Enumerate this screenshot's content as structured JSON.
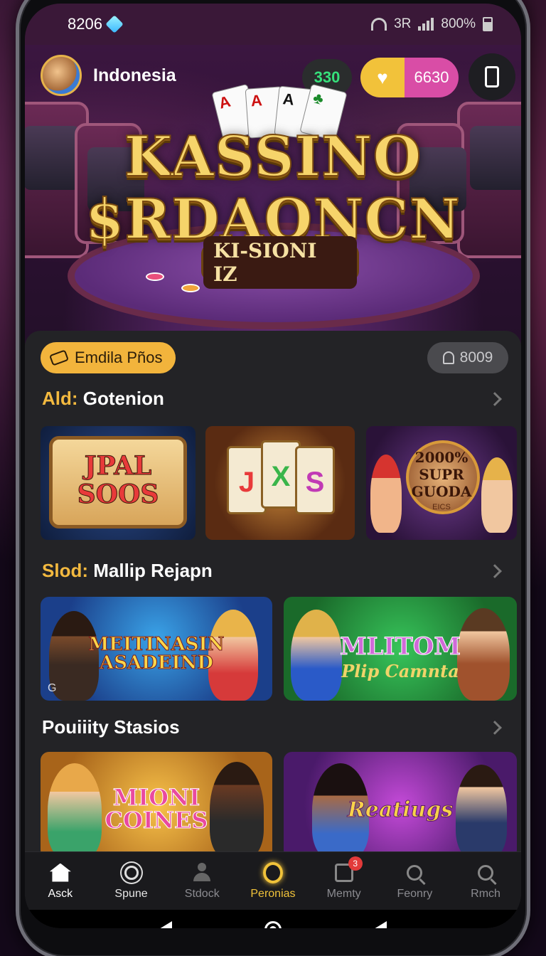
{
  "status": {
    "time": "8206",
    "carrier_text": "3R",
    "battery": "800%"
  },
  "header": {
    "country": "Indonesia",
    "green_counter": "330",
    "coin_value": "6630"
  },
  "hero": {
    "title_line1": "KASSINO",
    "title_line2": "$RDAONCN",
    "subtitle": "KI-SIONI IZ",
    "cards": [
      "A",
      "A",
      "A"
    ]
  },
  "promo": {
    "label": "Emdila Pños",
    "count": "8009"
  },
  "sections": [
    {
      "accent": "Ald:",
      "title": "Gotenion"
    },
    {
      "accent": "Slod:",
      "title": "Mallip Rejapn"
    },
    {
      "accent": "",
      "title": "Pouiiity Stasios"
    }
  ],
  "tiles": {
    "t1_line1": "JPAL",
    "t1_line2": "SOOS",
    "t2_reels": [
      "J",
      "X",
      "S"
    ],
    "t3_line1": "2000%",
    "t3_line2": "SUPR",
    "t3_line3": "GUODA",
    "t3_small": "EICS",
    "w1_line1": "MEITINASIN",
    "w1_line2": "ASADEIND",
    "w1_badge": "G",
    "w2_line1": "MLITOM",
    "w2_line2": "Plip Camnta",
    "w3_line1": "MIONI",
    "w3_line2": "COINES",
    "w4_line1": "Reatiugs"
  },
  "bottom_nav": [
    {
      "label": "Asck",
      "icon": "home-icon"
    },
    {
      "label": "Spune",
      "icon": "sun-icon"
    },
    {
      "label": "Stdock",
      "icon": "user-icon"
    },
    {
      "label": "Peronias",
      "icon": "ring-icon"
    },
    {
      "label": "Memty",
      "icon": "bag-icon",
      "badge": "3"
    },
    {
      "label": "Feonry",
      "icon": "search-icon"
    },
    {
      "label": "Rmch",
      "icon": "search-icon"
    }
  ],
  "colors": {
    "accent_gold": "#f3b93f",
    "coin_pink": "#d94da6",
    "green": "#36e07a"
  }
}
